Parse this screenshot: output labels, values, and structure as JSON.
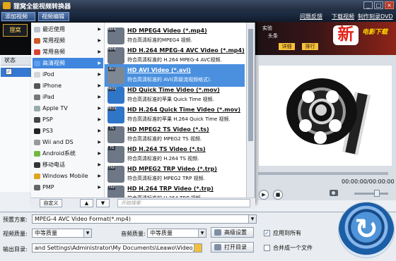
{
  "window": {
    "title": "狸窝全能视频转换器",
    "controls": [
      "_",
      "□",
      "×"
    ]
  },
  "toolbar": {
    "add_video": "添加视频",
    "video_edit": "视频编辑"
  },
  "top_links": [
    "问题反馈",
    "下载视频",
    "制作刻录DVD"
  ],
  "ad": {
    "brand": "狸窝",
    "line1": "实验",
    "line2": "头条",
    "new_char": "新",
    "side_text": "电影下载",
    "buttons": [
      "详细",
      "排行"
    ]
  },
  "file_list": {
    "header": "状态",
    "checked": "✓"
  },
  "menu": {
    "categories": [
      {
        "label": "最近使用",
        "active": false
      },
      {
        "label": "常用视频",
        "active": false
      },
      {
        "label": "常用音频",
        "active": false
      },
      {
        "label": "高清视频",
        "active": true
      },
      {
        "label": "iPod",
        "active": false
      },
      {
        "label": "iPhone",
        "active": false
      },
      {
        "label": "iPad",
        "active": false
      },
      {
        "label": "Apple TV",
        "active": false
      },
      {
        "label": "PSP",
        "active": false
      },
      {
        "label": "PS3",
        "active": false
      },
      {
        "label": "Wii and DS",
        "active": false
      },
      {
        "label": "Android系统",
        "active": false
      },
      {
        "label": "移动电话",
        "active": false
      },
      {
        "label": "Windows Mobile",
        "active": false
      },
      {
        "label": "PMP",
        "active": false
      }
    ],
    "formats": [
      {
        "title": "HD MPEG4 Video (*.mp4)",
        "desc": "符合高清标准的MPEG4 视频.",
        "tag": "MP4",
        "active": false
      },
      {
        "title": "HD H.264 MPEG-4 AVC Video (*.mp4)",
        "desc": "符合高清标准的 H.264 MPEG-4 AVC视频.",
        "tag": "MP4",
        "active": false
      },
      {
        "title": "HD AVI Video (*.avi)",
        "desc": "符合高清标准的 AVI(高级流视频格式).",
        "tag": "AVI",
        "active": true
      },
      {
        "title": "HD Quick Time Video (*.mov)",
        "desc": "符合高清标准的苹果 Quick Time 视频.",
        "tag": "MOV",
        "active": false
      },
      {
        "title": "HD H.264 Quick Time Video (*.mov)",
        "desc": "符合高清标准的苹果 H.264 Quick Time 视频.",
        "tag": "MOV",
        "active": false
      },
      {
        "title": "HD MPEG2 TS Video (*.ts)",
        "desc": "符合高清标准的 MPEG2 TS 视频.",
        "tag": "TS",
        "active": false
      },
      {
        "title": "HD H.264 TS Video (*.ts)",
        "desc": "符合高清标准的 H.264 TS 视频.",
        "tag": "TS",
        "active": false
      },
      {
        "title": "HD MPEG2 TRP Video (*.trp)",
        "desc": "符合高清标准的 MPEG2 TRP 视频.",
        "tag": "TRP",
        "active": false
      },
      {
        "title": "HD H.264 TRP Video (*.trp)",
        "desc": "符合高清标准的 H.264 TRP 视频.",
        "tag": "TRP",
        "active": false
      }
    ],
    "custom": "自定义",
    "up": "▲",
    "down": "▼",
    "search_placeholder": "开始搜索"
  },
  "player": {
    "time": "00:00:00/00:00:00",
    "play": "▶",
    "stop": "■"
  },
  "settings": {
    "preset_label": "预置方案:",
    "preset_value": "MPEG-4 AVC Video Format(*.mp4)",
    "video_quality_label": "视频质量:",
    "video_quality_value": "中等质量",
    "audio_quality_label": "音频质量:",
    "audio_quality_value": "中等质量",
    "advanced": "高级设置",
    "apply_all": "应用到所有",
    "output_label": "输出目录:",
    "output_path": "and Settings\\Administrator\\My Documents\\Leawo\\Video_Conver",
    "open_dir": "打开目录",
    "merge": "合并成一个文件",
    "check": "✓"
  },
  "convert": {
    "symbol": "↻"
  }
}
